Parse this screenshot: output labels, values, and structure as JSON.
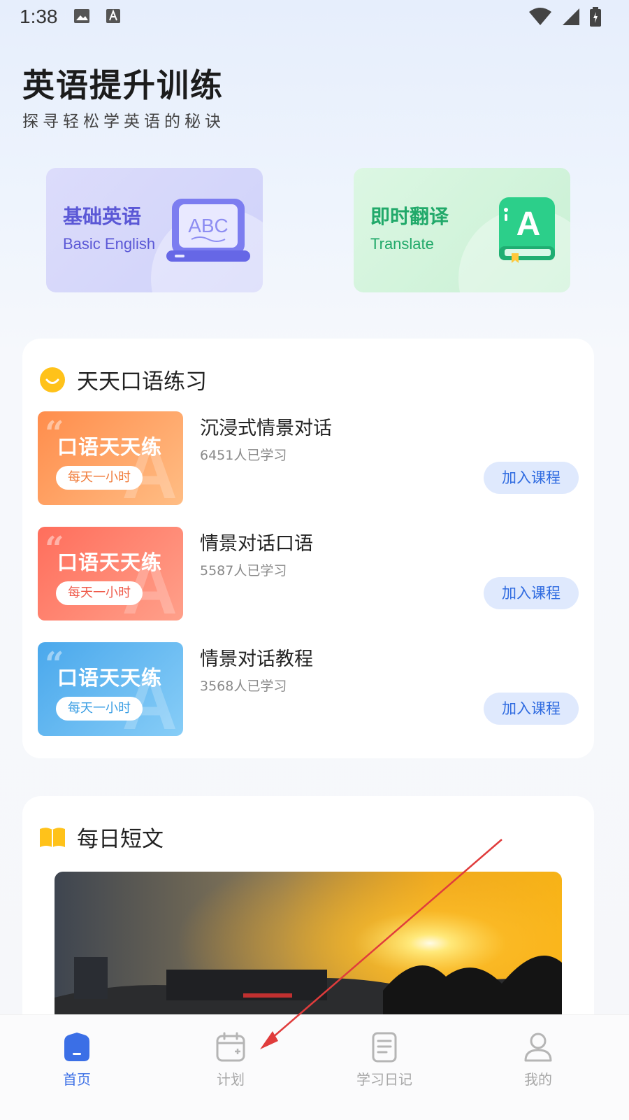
{
  "status_bar": {
    "time": "1:38"
  },
  "header": {
    "title": "英语提升训练",
    "subtitle": "探寻轻松学英语的秘诀"
  },
  "feature_cards": [
    {
      "title": "基础英语",
      "subtitle": "Basic English",
      "art_text": "ABC",
      "accent": "#5b58d6"
    },
    {
      "title": "即时翻译",
      "subtitle": "Translate",
      "art_text": "A",
      "accent": "#21a96a"
    }
  ],
  "speaking_section": {
    "title": "天天口语练习",
    "courses": [
      {
        "name": "沉浸式情景对话",
        "learners": "6451人已学习",
        "thumb_title": "口语天天练",
        "thumb_tag": "每天一小时",
        "button": "加入课程"
      },
      {
        "name": "情景对话口语",
        "learners": "5587人已学习",
        "thumb_title": "口语天天练",
        "thumb_tag": "每天一小时",
        "button": "加入课程"
      },
      {
        "name": "情景对话教程",
        "learners": "3568人已学习",
        "thumb_title": "口语天天练",
        "thumb_tag": "每天一小时",
        "button": "加入课程"
      }
    ]
  },
  "reading_section": {
    "title": "每日短文"
  },
  "tab_bar": {
    "items": [
      {
        "label": "首页",
        "icon": "home-icon",
        "active": true
      },
      {
        "label": "计划",
        "icon": "calendar-icon",
        "active": false
      },
      {
        "label": "学习日记",
        "icon": "notebook-icon",
        "active": false
      },
      {
        "label": "我的",
        "icon": "profile-icon",
        "active": false
      }
    ]
  },
  "colors": {
    "primary": "#3b6fe6",
    "annotation_arrow": "#e03c3c"
  }
}
